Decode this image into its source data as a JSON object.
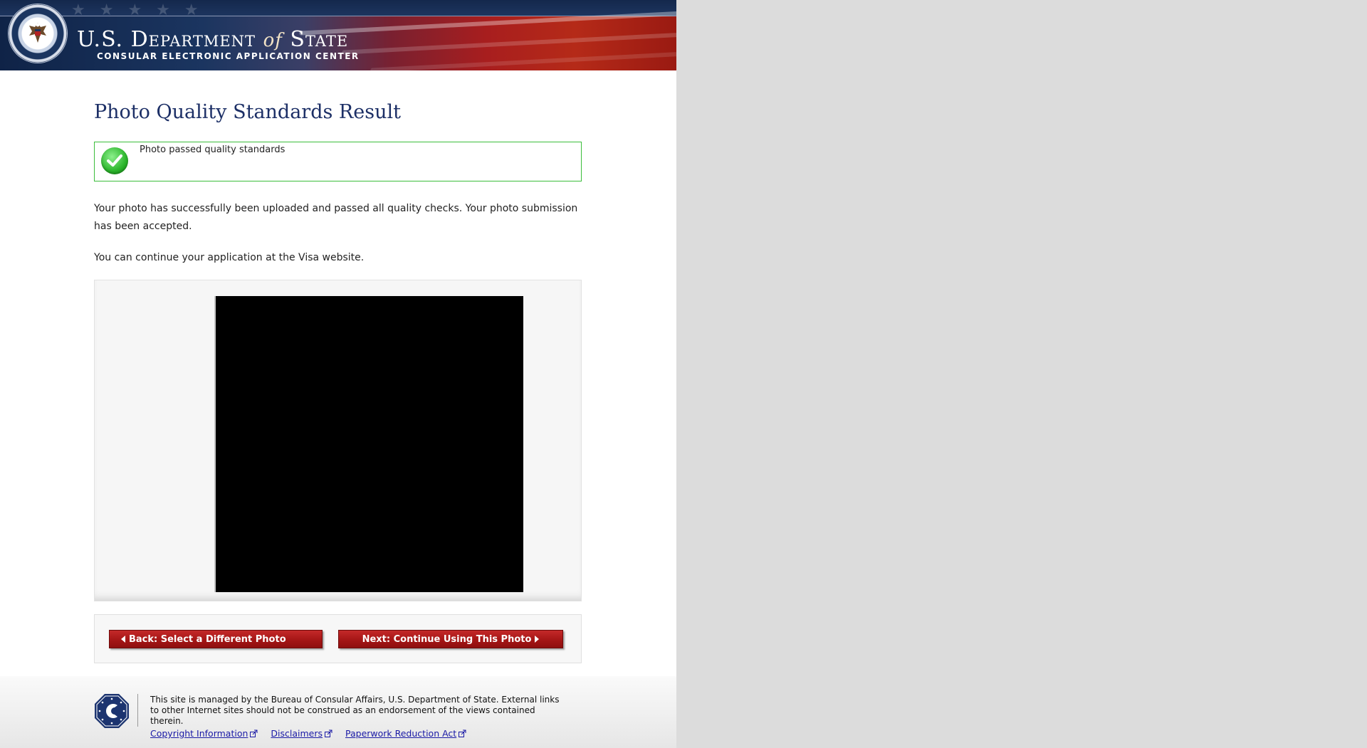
{
  "header": {
    "agency_title_prefix": "U.S. Department ",
    "agency_title_of": "of",
    "agency_title_suffix": " State",
    "agency_subtitle": "CONSULAR ELECTRONIC APPLICATION CENTER",
    "seal_icon": "department-of-state-seal"
  },
  "main": {
    "title": "Photo Quality Standards Result",
    "status": {
      "icon": "green-check-icon",
      "text": "Photo passed quality standards",
      "border_color": "#3bbd3b"
    },
    "paragraph_1": "Your photo has successfully been uploaded and passed all quality checks. Your photo submission has been accepted.",
    "paragraph_2": "You can continue your application at the Visa website."
  },
  "navigation": {
    "back_label": "Back: Select a Different Photo",
    "next_label": "Next: Continue Using This Photo",
    "button_color": "#a51616"
  },
  "footer": {
    "logo_icon": "consular-affairs-c-icon",
    "text": "This site is managed by the Bureau of Consular Affairs, U.S. Department of State. External links to other Internet sites should not be construed as an endorsement of the views contained therein.",
    "links": {
      "copyright": "Copyright Information",
      "disclaimers": "Disclaimers",
      "paperwork": "Paperwork Reduction Act"
    }
  }
}
